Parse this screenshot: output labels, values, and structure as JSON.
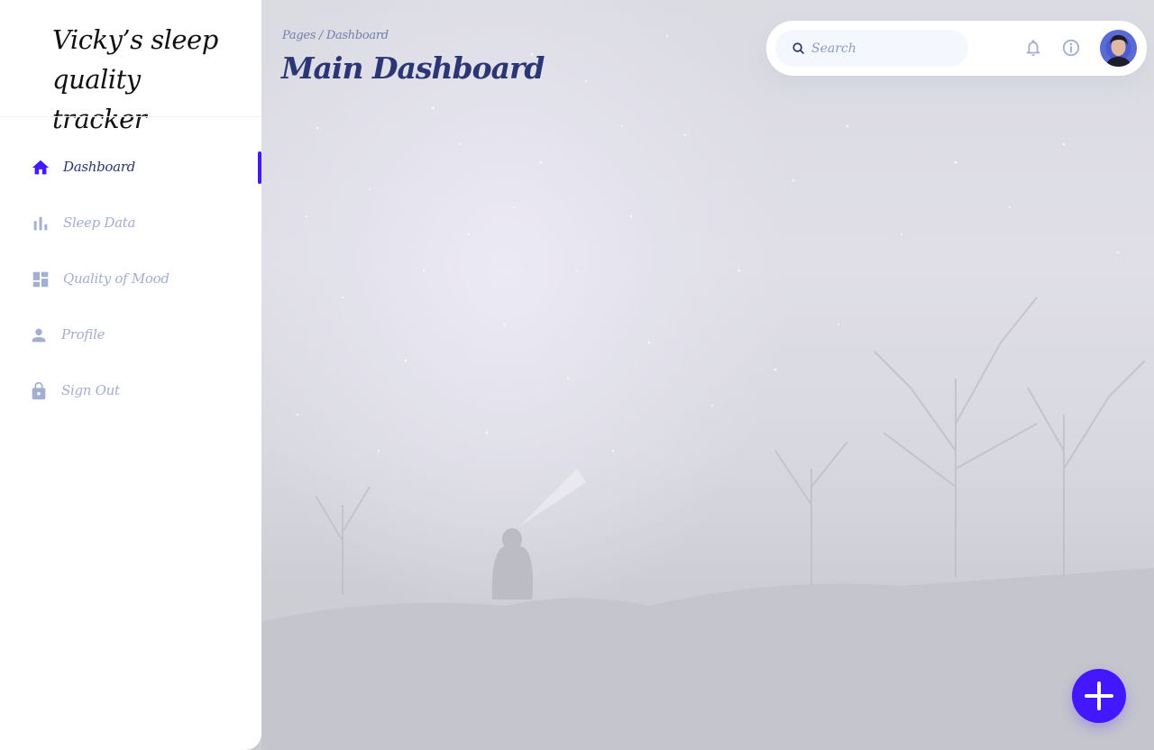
{
  "app": {
    "title": "Vicky's sleep quality tracker",
    "brand_line1": "Vicky’s sleep",
    "brand_line2": "quality tracker"
  },
  "sidebar": {
    "items": [
      {
        "label": "Dashboard",
        "icon": "home-icon",
        "active": true
      },
      {
        "label": "Sleep Data",
        "icon": "bar-chart-icon",
        "active": false
      },
      {
        "label": "Quality of Mood",
        "icon": "dashboard-grid-icon",
        "active": false
      },
      {
        "label": "Profile",
        "icon": "person-icon",
        "active": false
      },
      {
        "label": "Sign Out",
        "icon": "lock-icon",
        "active": false
      }
    ]
  },
  "header": {
    "breadcrumb": "Pages / Dashboard",
    "title": "Main Dashboard"
  },
  "topbar": {
    "search_placeholder": "Search",
    "notification_icon": "bell-icon",
    "info_icon": "info-icon",
    "avatar_icon": "user-avatar"
  },
  "fab": {
    "icon": "plus-icon"
  },
  "colors": {
    "accent": "#4318ff",
    "navy": "#2b3674",
    "muted": "#a3aed0",
    "search_bg": "#f4f7fe"
  }
}
